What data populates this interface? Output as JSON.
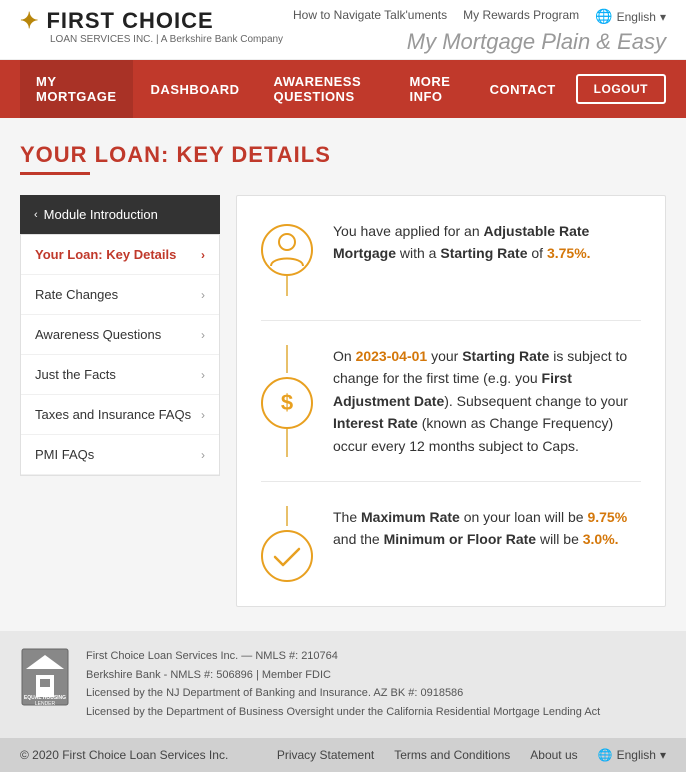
{
  "header": {
    "logo_icon": "✦",
    "logo_title": "FIRST CHOICE",
    "logo_subtitle": "LOAN SERVICES INC. | A Berkshire Bank Company",
    "tagline": "My Mortgage Plain & Easy",
    "links": [
      {
        "label": "How to Navigate Talk'uments",
        "url": "#"
      },
      {
        "label": "My Rewards Program",
        "url": "#"
      }
    ],
    "language": "English"
  },
  "nav": {
    "items": [
      {
        "label": "MY MORTGAGE",
        "active": true
      },
      {
        "label": "DASHBOARD"
      },
      {
        "label": "AWARENESS QUESTIONS"
      },
      {
        "label": "MORE INFO"
      },
      {
        "label": "CONTACT"
      }
    ],
    "logout_label": "LOGOUT"
  },
  "page": {
    "title": "YOUR LOAN: KEY DETAILS"
  },
  "sidebar": {
    "module_label": "Module Introduction",
    "items": [
      {
        "label": "Your Loan: Key Details",
        "active": true
      },
      {
        "label": "Rate Changes"
      },
      {
        "label": "Awareness Questions"
      },
      {
        "label": "Just the Facts"
      },
      {
        "label": "Taxes and Insurance FAQs"
      },
      {
        "label": "PMI FAQs"
      }
    ]
  },
  "blocks": [
    {
      "id": "block1",
      "text_parts": [
        {
          "text": "You have applied for an "
        },
        {
          "text": "Adjustable Rate Mortgage",
          "bold": true
        },
        {
          "text": "with a "
        },
        {
          "text": "Starting Rate",
          "bold": true
        },
        {
          "text": " of "
        },
        {
          "text": "3.75%.",
          "orange": true
        }
      ]
    },
    {
      "id": "block2",
      "text_parts": [
        {
          "text": "On "
        },
        {
          "text": "2023-04-01",
          "orange_date": true
        },
        {
          "text": " your "
        },
        {
          "text": "Starting Rate",
          "bold": true
        },
        {
          "text": " is subject to change for the first time (e.g. you "
        },
        {
          "text": "First Adjustment Date",
          "bold": true
        },
        {
          "text": "). Subsequent change to your "
        },
        {
          "text": "Interest Rate",
          "bold": true
        },
        {
          "text": " (known as Change Frequency) occur every 12 months subject to Caps."
        }
      ]
    },
    {
      "id": "block3",
      "text_parts": [
        {
          "text": "The "
        },
        {
          "text": "Maximum Rate",
          "bold": true
        },
        {
          "text": " on your loan will be "
        },
        {
          "text": "9.75%",
          "orange": true
        },
        {
          "text": " and the "
        },
        {
          "text": "Minimum or Floor Rate",
          "bold": true
        },
        {
          "text": " will be "
        },
        {
          "text": "3.0%.",
          "orange": true
        }
      ]
    }
  ],
  "footer": {
    "company_lines": [
      "First Choice Loan Services Inc. — NMLS #: 210764",
      "Berkshire Bank - NMLS #: 506896 | Member FDIC",
      "Licensed by the NJ Department of Banking and Insurance. AZ BK #: 0918586",
      "Licensed by the Department of Business Oversight under the California Residential Mortgage Lending Act"
    ],
    "copyright": "© 2020 First Choice Loan Services Inc.",
    "links": [
      "Privacy Statement",
      "Terms and Conditions",
      "About us"
    ],
    "language": "English"
  }
}
